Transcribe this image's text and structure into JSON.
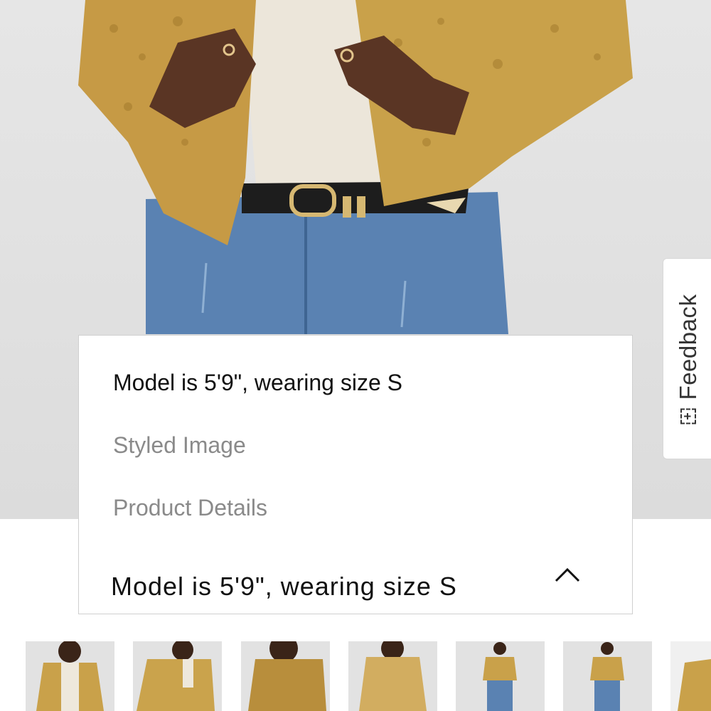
{
  "feedback": {
    "label": "Feedback",
    "icon": "plus-box-icon"
  },
  "dropdown": {
    "options": [
      {
        "label": "Model is 5'9\", wearing size S",
        "active": true
      },
      {
        "label": "Styled Image",
        "active": false
      },
      {
        "label": "Product Details",
        "active": false
      }
    ],
    "selected_label": "Model is 5'9\", wearing size S",
    "toggle_icon": "chevron-up-icon"
  },
  "thumbnails": {
    "count": 7
  },
  "colors": {
    "jacket_gold": "#c9a14a",
    "denim": "#4f78a8",
    "backdrop": "#e0e0e0"
  }
}
